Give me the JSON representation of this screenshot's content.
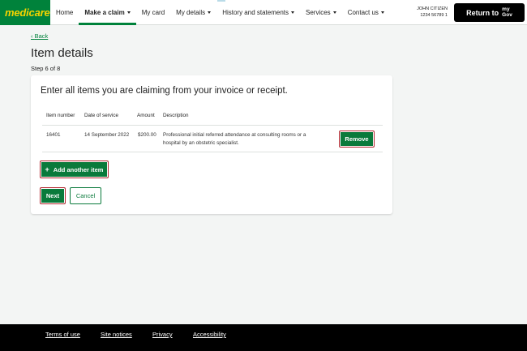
{
  "header": {
    "logo": "medicare",
    "nav": [
      {
        "label": "Home",
        "dropdown": false,
        "active": false
      },
      {
        "label": "Make a claim",
        "dropdown": true,
        "active": true
      },
      {
        "label": "My card",
        "dropdown": false,
        "active": false
      },
      {
        "label": "My details",
        "dropdown": true,
        "active": false
      },
      {
        "label": "History and statements",
        "dropdown": true,
        "active": false
      },
      {
        "label": "Services",
        "dropdown": true,
        "active": false
      },
      {
        "label": "Contact us",
        "dropdown": true,
        "active": false
      }
    ],
    "user_name": "JOHN CITIZEN",
    "user_number": "1234 56789 1",
    "return_label": "Return to",
    "mygov_top": "my",
    "mygov_bottom": "Gov"
  },
  "page": {
    "back_label": "Back",
    "title": "Item details",
    "step": "Step 6 of 8"
  },
  "card": {
    "heading": "Enter all items you are claiming from your invoice or receipt.",
    "columns": [
      "Item number",
      "Date of service",
      "Amount",
      "Description"
    ],
    "rows": [
      {
        "item_number": "16401",
        "date": "14 September 2022",
        "amount": "$200.00",
        "description_line1": "Professional initial referred attendance at consulting rooms or a",
        "description_line2": "hospital by an obstetric specialist.",
        "remove_label": "Remove"
      }
    ],
    "add_label": "Add another item",
    "next_label": "Next",
    "cancel_label": "Cancel"
  },
  "footer": {
    "links": [
      "Terms of use",
      "Site notices",
      "Privacy",
      "Accessibility"
    ]
  },
  "colors": {
    "brand_green": "#00823b",
    "logo_yellow": "#f5d300",
    "button_green": "#0a7a3b",
    "focus_red": "#b3262f"
  }
}
